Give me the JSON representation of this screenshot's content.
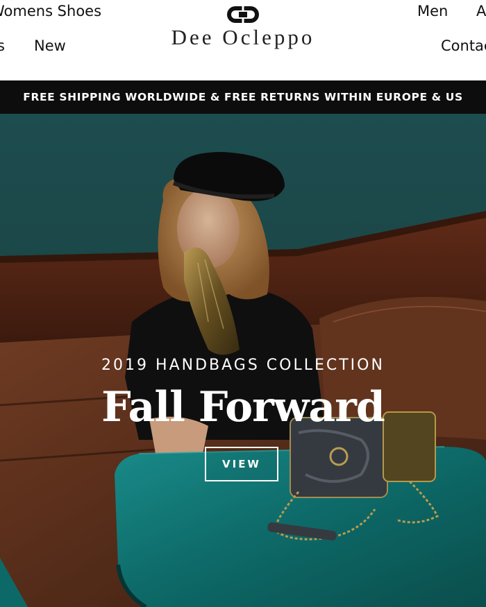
{
  "nav": {
    "top_left": "Womens Shoes",
    "bottom_left_partial": "s",
    "new": "New",
    "men": "Men",
    "top_right_partial": "A",
    "contact": "Contact"
  },
  "brand": {
    "name": "Dee Ocleppo",
    "logo_icon": "dee-ocleppo-monogram-icon"
  },
  "banner": {
    "text": "FREE SHIPPING WORLDWIDE & FREE RETURNS WITHIN EUROPE & US"
  },
  "hero": {
    "subtitle": "2019 HANDBAGS COLLECTION",
    "title": "Fall Forward",
    "button_label": "VIEW"
  },
  "colors": {
    "wall_teal": "#1d4a4c",
    "table_teal": "#14807e",
    "leather_brown": "#5a2f1c",
    "banner_black": "#0d0d0d",
    "text_white": "#ffffff"
  }
}
